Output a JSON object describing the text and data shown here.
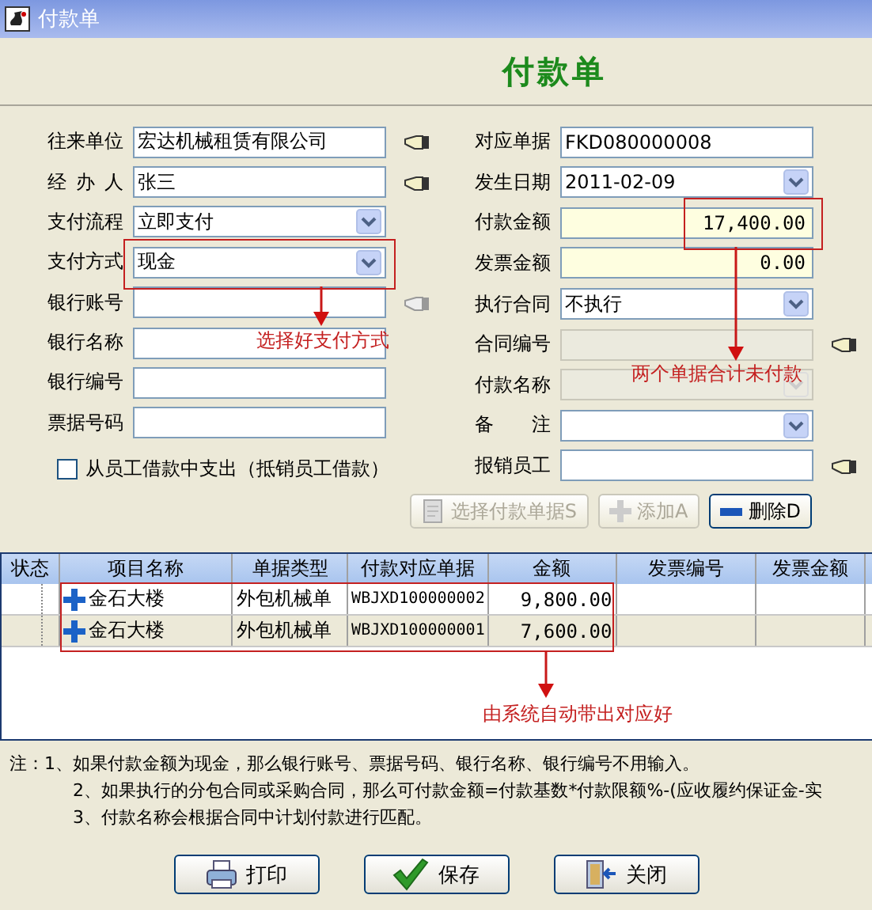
{
  "window": {
    "title": "付款单"
  },
  "heading": "付款单",
  "left_fields": [
    {
      "label": "往来单位",
      "kind": "text",
      "value": "宏达机械租赁有限公司",
      "lookup": true,
      "lookup_disabled": false
    },
    {
      "label": "经 办 人",
      "kind": "text",
      "value": "张三",
      "lookup": true,
      "lookup_disabled": false
    },
    {
      "label": "支付流程",
      "kind": "select",
      "value": "立即支付"
    },
    {
      "label": "支付方式",
      "kind": "select",
      "value": "现金"
    },
    {
      "label": "银行账号",
      "kind": "text",
      "lookup": true,
      "lookup_disabled": true
    },
    {
      "label": "银行名称",
      "kind": "text"
    },
    {
      "label": "银行编号",
      "kind": "text"
    },
    {
      "label": "票据号码",
      "kind": "text"
    }
  ],
  "deduct_checkbox": {
    "label": "从员工借款中支出（抵销员工借款）",
    "checked": false
  },
  "right_fields": [
    {
      "label": "对应单据",
      "kind": "text",
      "value": "FKD080000008"
    },
    {
      "label": "发生日期",
      "kind": "select",
      "value": "2011-02-09"
    },
    {
      "label": "付款金额",
      "kind": "amount",
      "value": "17,400.00"
    },
    {
      "label": "发票金额",
      "kind": "amount",
      "value": "0.00"
    },
    {
      "label": "执行合同",
      "kind": "select",
      "value": "不执行"
    },
    {
      "label": "合同编号",
      "kind": "text",
      "disabled": true,
      "lookup": true,
      "lookup_disabled": false
    },
    {
      "label": "付款名称",
      "kind": "select",
      "disabled": true
    },
    {
      "label": "备 注",
      "kind": "select"
    },
    {
      "label": "报销员工",
      "kind": "text",
      "lookup": true,
      "lookup_disabled": false
    }
  ],
  "toolbar": [
    {
      "label": "选择付款单据S",
      "disabled": true
    },
    {
      "label": "添加A",
      "disabled": true
    },
    {
      "label": "删除D",
      "disabled": false
    }
  ],
  "table": {
    "columns": [
      "状态",
      "项目名称",
      "单据类型",
      "付款对应单据",
      "金额",
      "发票编号",
      "发票金额"
    ],
    "rows": [
      {
        "project": "金石大楼",
        "type": "外包机械单",
        "document": "WBJXD100000002",
        "amount": "9,800.00"
      },
      {
        "project": "金石大楼",
        "type": "外包机械单",
        "document": "WBJXD100000001",
        "amount": "7,600.00"
      }
    ]
  },
  "notes": {
    "label": "注：",
    "items": [
      "1、如果付款金额为现金，那么银行账号、票据号码、银行名称、银行编号不用输入。",
      "2、如果执行的分包合同或采购合同，那么可付款金额=付款基数*付款限额%-(应收履约保证金-实",
      "3、付款名称会根据合同中计划付款进行匹配。"
    ]
  },
  "buttons": [
    {
      "label": "打印"
    },
    {
      "label": "保存"
    },
    {
      "label": "关闭"
    }
  ],
  "annotations": [
    {
      "text": "选择好支付方式"
    },
    {
      "text": "两个单据合计未付款"
    },
    {
      "text": "由系统自动带出对应好"
    }
  ]
}
